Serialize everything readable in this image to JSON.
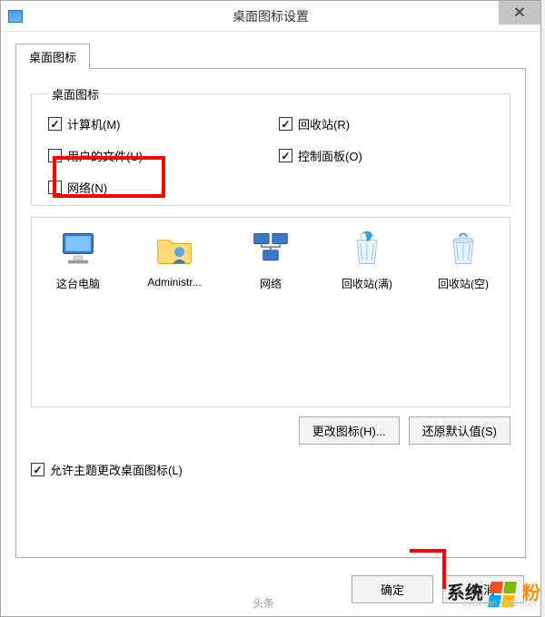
{
  "window": {
    "title": "桌面图标设置",
    "close_glyph": "✕"
  },
  "tabs": {
    "main_label": "桌面图标"
  },
  "group": {
    "legend": "桌面图标"
  },
  "checkboxes": {
    "computer": {
      "label": "计算机(M)",
      "checked": true
    },
    "recyclebin": {
      "label": "回收站(R)",
      "checked": true
    },
    "user_files": {
      "label": "用户的文件(U)",
      "checked": false
    },
    "control_panel": {
      "label": "控制面板(O)",
      "checked": true
    },
    "network": {
      "label": "网络(N)",
      "checked": false
    }
  },
  "icons": [
    {
      "id": "this-pc",
      "label": "这台电脑"
    },
    {
      "id": "administrator",
      "label": "Administr..."
    },
    {
      "id": "network",
      "label": "网络"
    },
    {
      "id": "recycle-full",
      "label": "回收站(满)"
    },
    {
      "id": "recycle-empty",
      "label": "回收站(空)"
    }
  ],
  "buttons": {
    "change_icon": "更改图标(H)...",
    "restore_defaults": "还原默认值(S)",
    "ok": "确定",
    "cancel": "取消"
  },
  "allow_theme": {
    "label": "允许主题更改桌面图标(L)",
    "checked": true
  },
  "watermark": {
    "brand_prefix": "系统",
    "brand_suffix": "粉",
    "url": "www.win7999.com",
    "toutiao": "头条"
  }
}
